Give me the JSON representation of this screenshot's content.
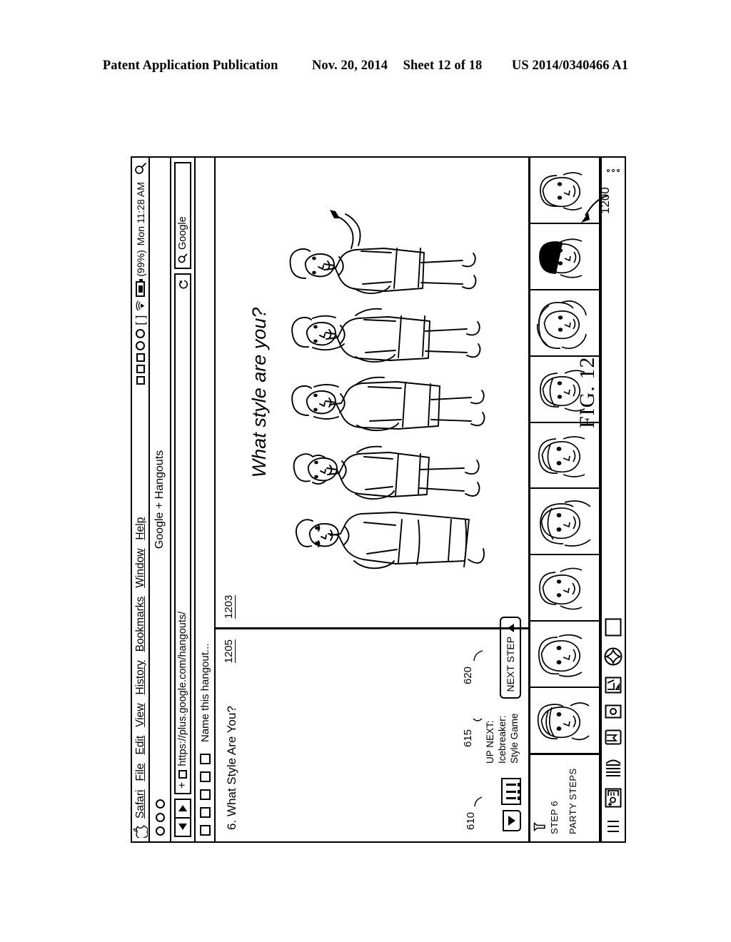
{
  "page_header": {
    "left": "Patent Application Publication",
    "date": "Nov. 20, 2014",
    "sheet": "Sheet 12 of 18",
    "patent_number": "US 2014/0340466 A1"
  },
  "figure": {
    "label": "FIG. 12",
    "ref_window": "1200",
    "ref_video_stage": "1203",
    "ref_steps_panel": "1205",
    "ref_dropdown": "610",
    "ref_upnext": "615",
    "ref_next_step": "620"
  },
  "menubar": {
    "apple_icon": "apple-logo-icon",
    "items": [
      {
        "label": "Safari",
        "accel": "S"
      },
      {
        "label": "File",
        "accel": "F"
      },
      {
        "label": "Edit",
        "accel": "E"
      },
      {
        "label": "View",
        "accel": "V"
      },
      {
        "label": "History",
        "accel": "H"
      },
      {
        "label": "Bookmarks",
        "accel": "B"
      },
      {
        "label": "Window",
        "accel": "W"
      },
      {
        "label": "Help",
        "accel": "H"
      }
    ],
    "status": {
      "battery": "(99%)",
      "clock": "Mon 11:28 AM",
      "wifi_icon": "wifi-icon",
      "battery_icon": "battery-icon",
      "search_icon": "spotlight-search-icon"
    }
  },
  "window": {
    "title": "Google + Hangouts",
    "traffic_lights": [
      "close-button",
      "minimize-button",
      "zoom-button"
    ]
  },
  "toolbar": {
    "back_icon": "back-arrow-icon",
    "forward_icon": "forward-arrow-icon",
    "url_plus": "+",
    "url_value": "https://plus.google.com/hangouts/",
    "reload_icon": "reload-icon",
    "search_icon": "search-icon",
    "search_placeholder": "Google"
  },
  "bookmarkbar": {
    "name_field": "Name this hangout...",
    "items": [
      "bookmark-1",
      "bookmark-2",
      "bookmark-3",
      "bookmark-4",
      "bookmark-5"
    ]
  },
  "steps_panel": {
    "title": "6. What Style Are You?",
    "dropdown_icon": "dropdown-triangle-icon",
    "settings_icon": "sliders-icon",
    "up_next_line1": "UP NEXT:",
    "up_next_line2": "Icebreaker:",
    "up_next_line3": "Style Game",
    "next_step_label": "NEXT STEP",
    "next_step_icon": "triangle-up-icon"
  },
  "stage": {
    "caption": "What style are you?",
    "art_description": "five-fashion-figures-line-art"
  },
  "filmstrip": {
    "label_party_steps": "PARTY STEPS",
    "label_step": "STEP 6",
    "cup_icon": "cup-icon",
    "participants": [
      "participant-1",
      "participant-2",
      "participant-3",
      "participant-4",
      "participant-5",
      "participant-6",
      "participant-7",
      "participant-8",
      "participant-9"
    ]
  },
  "bottom_toolbar": {
    "icons": [
      "sidebar-icon",
      "add-contact-icon",
      "book-icon",
      "bookmark-icon",
      "camera-icon",
      "share-icon",
      "star-icon",
      "window-icon",
      "more-icon"
    ]
  }
}
